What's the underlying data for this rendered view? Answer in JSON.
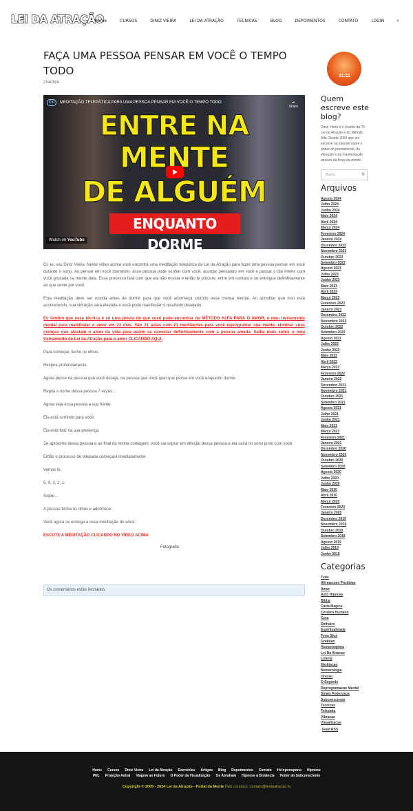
{
  "header": {
    "logo": "LEI DA ATRAÇÃO",
    "nav": [
      "Home",
      "CURSOS",
      "DINIZ VIEIRA",
      "LEI DA ATRAÇÃO",
      "TECNICAS",
      "BLOG",
      "DEPOIMENTOS",
      "CONTATO",
      "LOGIN"
    ],
    "search_icon": "⌕"
  },
  "post": {
    "title": "FAÇA UMA PESSOA PENSAR EM VOCÊ O TEMPO TODO",
    "date": "27/4/2024",
    "video": {
      "title": "MEDITAÇÃO TELEPÁTICA PARA UMA PESSOA PENSAR EM VOCÊ O TEMPO TODO",
      "thumb_line1": "ENTRE NA",
      "thumb_line2": "MENTE",
      "thumb_line3": "DE ALGUÉM",
      "thumb_banner": "ENQUANTO DORME",
      "share": "Share",
      "watch_on": "Watch on",
      "youtube": "YouTube",
      "channel_badge": "CXI"
    },
    "paragraphs": [
      "Oi, eu sou Diniz Vieira. Neste vídeo acima você encontra uma meditação telepática da Lei da Atração para fazer uma pessoa pensar em você durante o sono. Ao pensar em você dormindo, essa pessoa pode sonhar com você, acordar pensando em você e passar o dia inteiro com você grudada na mente dela. Esse processo fará com que ela não resista e então te procure, entre em contato e se entregue definitivamente ao que sente por você.",
      "Esta meditação deve ser ouvida antes de dormir para que você adormeça criando essa crença mental. Ao acreditar que isso está acontecendo, sua vibração será elevada e você pode manifestar o resultado desejado."
    ],
    "promo": "Eu lembro que essa técnica é só uma prévia do que você pode encontrar no MÉTODO ALFA PARA O AMOR, o meu treinamento mental para manifestar o amor em 21 dias. São 21 aulas com 21 meditações para você reprogramar sua mente, eliminar suas crenças que afastam o amor da vida para assim se conectar definitivamente com a pessoa amada. Saiba mais sobre o meu treinamento da Lei da Atração para o amor CLICANDO AQUI.",
    "steps": [
      "Para começar, feche os olhos.",
      "Respire profundamente.",
      "Agora pense na pessoa que você deseja, na pessoa que você quer que pense em você enquanto dorme…",
      "Repita o nome dessa pessoa 7 vezes…",
      "Agora veja essa pessoa a sua frente.",
      "Ela está sorrindo para você.",
      "Ela está feliz na sua presença.",
      "Se aproxime dessa pessoa e ao final da minha contagem, você vai soprar em direção dessa pessoa e ela cairá no sono junto com você.",
      "Então o processo de telepatia começará imediatamente.",
      "Vamos lá.",
      "5, 4, 3, 2, 1.",
      "Sopre…",
      "A pessoa fecha os olhos e adormece.",
      "Você agora se entrega a essa meditação do amor."
    ],
    "cta": "ESCUTE A MEDITAÇÃO CLICANDO NO VÍDEO ACIMA",
    "photo_alt": "Fotografia",
    "comments_closed": "Os comentários estão fechados."
  },
  "sidebar": {
    "avatar_number": "11:11",
    "who_title": "Quem escreve este blog?",
    "bio": "Diniz Vieira é o criador da TV Lei da Atração e do Método Alfa. Desde 2009 que ele escreve na internet sobre o poder do pensamento, da vibração e da manifestação através da força da mente.",
    "search_placeholder": "Busca",
    "archives_title": "Arquivos",
    "archives": [
      "Agosto 2024",
      "Julho 2024",
      "Junho 2024",
      "Maio 2024",
      "Abril 2024",
      "Março 2024",
      "Fevereiro 2024",
      "Janeiro 2024",
      "Dezembro 2023",
      "Novembro 2023",
      "Outubro 2023",
      "Setembro 2023",
      "Agosto 2023",
      "Julho 2023",
      "Junho 2023",
      "Maio 2023",
      "Abril 2023",
      "Março 2023",
      "Fevereiro 2023",
      "Janeiro 2023",
      "Dezembro 2022",
      "Novembro 2022",
      "Outubro 2022",
      "Setembro 2022",
      "Agosto 2022",
      "Julho 2022",
      "Junho 2022",
      "Maio 2022",
      "Abril 2022",
      "Março 2022",
      "Fevereiro 2022",
      "Janeiro 2022",
      "Dezembro 2021",
      "Novembro 2021",
      "Outubro 2021",
      "Setembro 2021",
      "Agosto 2021",
      "Julho 2021",
      "Junho 2021",
      "Maio 2021",
      "Março 2021",
      "Fevereiro 2021",
      "Janeiro 2021",
      "Dezembro 2020",
      "Novembro 2020",
      "Outubro 2020",
      "Setembro 2020",
      "Agosto 2020",
      "Julho 2020",
      "Junho 2020",
      "Maio 2020",
      "Abril 2020",
      "Março 2020",
      "Fevereiro 2020",
      "Janeiro 2020",
      "Dezembro 2019",
      "Novembro 2019",
      "Outubro 2019",
      "Setembro 2019",
      "Agosto 2019",
      "Julho 2019",
      "Junho 2019"
    ],
    "categories_title": "Categorias",
    "categories": [
      "Tudo",
      "Afirmacoes Positivas",
      "Amor",
      "Auto Hipnose",
      "Biblia",
      "Carta Magica",
      "Cerebro Humano",
      "Cura",
      "Dinheiro",
      "Espiritualidade",
      "Feng Shui",
      "Gratidao",
      "Hooponopono",
      "Lei Da Atracao",
      "Loteria",
      "Meditacao",
      "Numerologia",
      "Oracao",
      "O Segredo",
      "Reprogramacao Mental",
      "Sinais Poderosos",
      "Subconsciente",
      "Tecnicas",
      "Telepatia",
      "Vibracao",
      "Visualizacao"
    ],
    "feed": "Feed RSS"
  },
  "footer": {
    "row1": [
      "Home",
      "Cursos",
      "Diniz Vieira",
      "Lei da Atração",
      "Exercícios",
      "Artigos",
      "Blog",
      "Depoimentos",
      "Contato",
      "Ho'oponopono",
      "Hipnose"
    ],
    "row2": [
      "PNL",
      "Projeção Astral",
      "Viagem ao Futuro",
      "O Poder da Visualização",
      "Os Abraham",
      "Hipnose à Distância",
      "Poder do Subconsciente"
    ],
    "copyright": "Copyright © 2009 - 2024 Lei da Atração - Portal da Mente",
    "contact": "Fale conosco: contato@leidaatracao.tv"
  }
}
